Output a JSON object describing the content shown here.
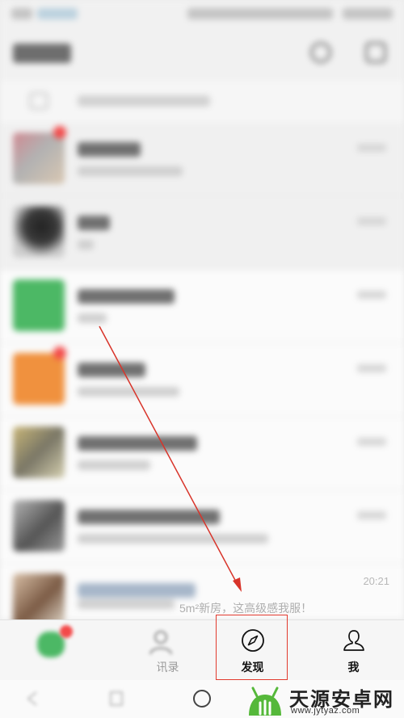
{
  "chat_list": {
    "last_row_time": "20:21",
    "last_row_preview": "5m²新房，这高级感我服！"
  },
  "tabs": [
    {
      "label": "",
      "icon": "chat-icon"
    },
    {
      "label": "讯录",
      "icon": "contacts-icon"
    },
    {
      "label": "发现",
      "icon": "compass-icon",
      "highlighted": true
    },
    {
      "label": "我",
      "icon": "person-icon"
    }
  ],
  "nav_bar": {
    "icons": [
      "back-icon",
      "home-icon",
      "recents-icon"
    ]
  },
  "annotation": {
    "color": "#e23a2e",
    "target": "发现"
  },
  "watermark": {
    "title": "天源安卓网",
    "url": "www.jytyaz.com",
    "color": "#55b83a"
  },
  "colors": {
    "accent_green": "#4cb865",
    "badge_red": "#f34a4a"
  }
}
